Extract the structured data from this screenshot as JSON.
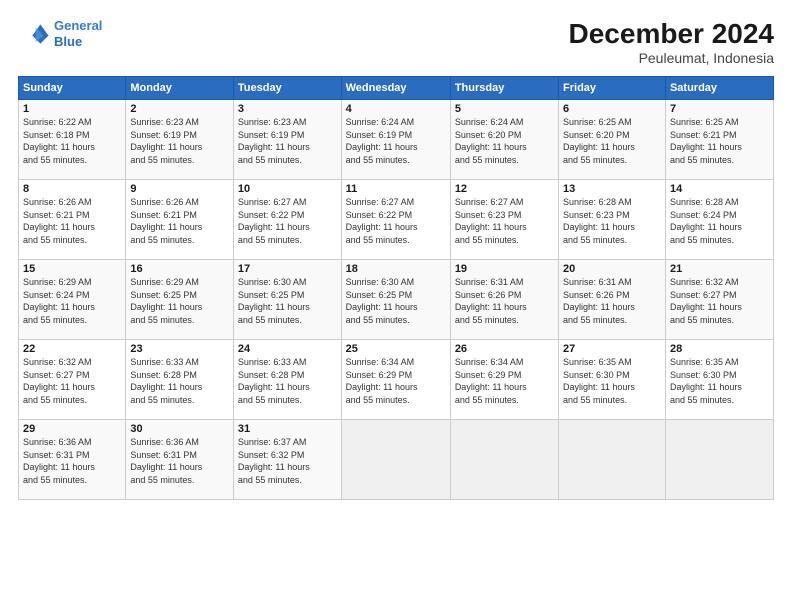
{
  "header": {
    "logo_line1": "General",
    "logo_line2": "Blue",
    "title": "December 2024",
    "subtitle": "Peuleumat, Indonesia"
  },
  "days_of_week": [
    "Sunday",
    "Monday",
    "Tuesday",
    "Wednesday",
    "Thursday",
    "Friday",
    "Saturday"
  ],
  "weeks": [
    [
      {
        "day": 1,
        "info": "Sunrise: 6:22 AM\nSunset: 6:18 PM\nDaylight: 11 hours\nand 55 minutes."
      },
      {
        "day": 2,
        "info": "Sunrise: 6:23 AM\nSunset: 6:19 PM\nDaylight: 11 hours\nand 55 minutes."
      },
      {
        "day": 3,
        "info": "Sunrise: 6:23 AM\nSunset: 6:19 PM\nDaylight: 11 hours\nand 55 minutes."
      },
      {
        "day": 4,
        "info": "Sunrise: 6:24 AM\nSunset: 6:19 PM\nDaylight: 11 hours\nand 55 minutes."
      },
      {
        "day": 5,
        "info": "Sunrise: 6:24 AM\nSunset: 6:20 PM\nDaylight: 11 hours\nand 55 minutes."
      },
      {
        "day": 6,
        "info": "Sunrise: 6:25 AM\nSunset: 6:20 PM\nDaylight: 11 hours\nand 55 minutes."
      },
      {
        "day": 7,
        "info": "Sunrise: 6:25 AM\nSunset: 6:21 PM\nDaylight: 11 hours\nand 55 minutes."
      }
    ],
    [
      {
        "day": 8,
        "info": "Sunrise: 6:26 AM\nSunset: 6:21 PM\nDaylight: 11 hours\nand 55 minutes."
      },
      {
        "day": 9,
        "info": "Sunrise: 6:26 AM\nSunset: 6:21 PM\nDaylight: 11 hours\nand 55 minutes."
      },
      {
        "day": 10,
        "info": "Sunrise: 6:27 AM\nSunset: 6:22 PM\nDaylight: 11 hours\nand 55 minutes."
      },
      {
        "day": 11,
        "info": "Sunrise: 6:27 AM\nSunset: 6:22 PM\nDaylight: 11 hours\nand 55 minutes."
      },
      {
        "day": 12,
        "info": "Sunrise: 6:27 AM\nSunset: 6:23 PM\nDaylight: 11 hours\nand 55 minutes."
      },
      {
        "day": 13,
        "info": "Sunrise: 6:28 AM\nSunset: 6:23 PM\nDaylight: 11 hours\nand 55 minutes."
      },
      {
        "day": 14,
        "info": "Sunrise: 6:28 AM\nSunset: 6:24 PM\nDaylight: 11 hours\nand 55 minutes."
      }
    ],
    [
      {
        "day": 15,
        "info": "Sunrise: 6:29 AM\nSunset: 6:24 PM\nDaylight: 11 hours\nand 55 minutes."
      },
      {
        "day": 16,
        "info": "Sunrise: 6:29 AM\nSunset: 6:25 PM\nDaylight: 11 hours\nand 55 minutes."
      },
      {
        "day": 17,
        "info": "Sunrise: 6:30 AM\nSunset: 6:25 PM\nDaylight: 11 hours\nand 55 minutes."
      },
      {
        "day": 18,
        "info": "Sunrise: 6:30 AM\nSunset: 6:25 PM\nDaylight: 11 hours\nand 55 minutes."
      },
      {
        "day": 19,
        "info": "Sunrise: 6:31 AM\nSunset: 6:26 PM\nDaylight: 11 hours\nand 55 minutes."
      },
      {
        "day": 20,
        "info": "Sunrise: 6:31 AM\nSunset: 6:26 PM\nDaylight: 11 hours\nand 55 minutes."
      },
      {
        "day": 21,
        "info": "Sunrise: 6:32 AM\nSunset: 6:27 PM\nDaylight: 11 hours\nand 55 minutes."
      }
    ],
    [
      {
        "day": 22,
        "info": "Sunrise: 6:32 AM\nSunset: 6:27 PM\nDaylight: 11 hours\nand 55 minutes."
      },
      {
        "day": 23,
        "info": "Sunrise: 6:33 AM\nSunset: 6:28 PM\nDaylight: 11 hours\nand 55 minutes."
      },
      {
        "day": 24,
        "info": "Sunrise: 6:33 AM\nSunset: 6:28 PM\nDaylight: 11 hours\nand 55 minutes."
      },
      {
        "day": 25,
        "info": "Sunrise: 6:34 AM\nSunset: 6:29 PM\nDaylight: 11 hours\nand 55 minutes."
      },
      {
        "day": 26,
        "info": "Sunrise: 6:34 AM\nSunset: 6:29 PM\nDaylight: 11 hours\nand 55 minutes."
      },
      {
        "day": 27,
        "info": "Sunrise: 6:35 AM\nSunset: 6:30 PM\nDaylight: 11 hours\nand 55 minutes."
      },
      {
        "day": 28,
        "info": "Sunrise: 6:35 AM\nSunset: 6:30 PM\nDaylight: 11 hours\nand 55 minutes."
      }
    ],
    [
      {
        "day": 29,
        "info": "Sunrise: 6:36 AM\nSunset: 6:31 PM\nDaylight: 11 hours\nand 55 minutes."
      },
      {
        "day": 30,
        "info": "Sunrise: 6:36 AM\nSunset: 6:31 PM\nDaylight: 11 hours\nand 55 minutes."
      },
      {
        "day": 31,
        "info": "Sunrise: 6:37 AM\nSunset: 6:32 PM\nDaylight: 11 hours\nand 55 minutes."
      },
      {
        "day": null,
        "info": ""
      },
      {
        "day": null,
        "info": ""
      },
      {
        "day": null,
        "info": ""
      },
      {
        "day": null,
        "info": ""
      }
    ]
  ]
}
